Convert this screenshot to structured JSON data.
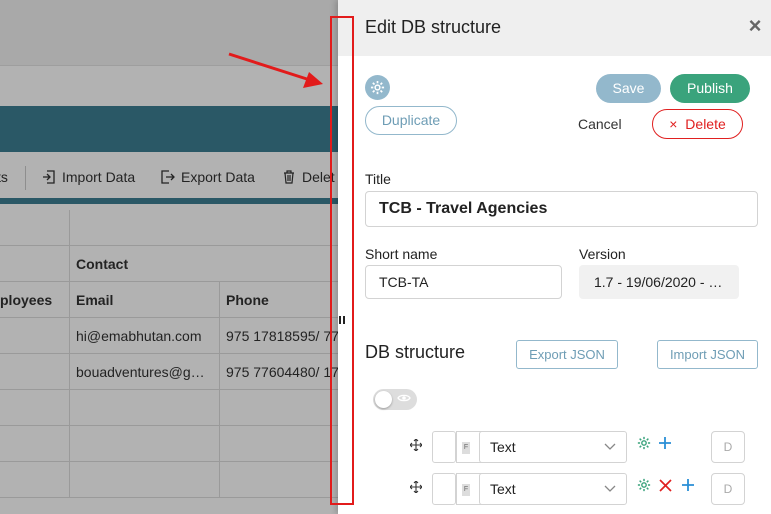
{
  "background": {
    "toolbar": {
      "items": [
        {
          "label": "ts",
          "icon": "cut-off-icon"
        },
        {
          "label": "Import Data",
          "icon": "import-icon"
        },
        {
          "label": "Export Data",
          "icon": "export-icon"
        },
        {
          "label": "Delet",
          "icon": "trash-icon"
        }
      ]
    },
    "table": {
      "group_header": "Contact",
      "headers": [
        "ployees",
        "Email",
        "Phone"
      ],
      "rows": [
        [
          "",
          "hi@emabhutan.com",
          "975 17818595/ 77"
        ],
        [
          "",
          "bouadventures@g…",
          "975 77604480/ 17"
        ],
        [
          "",
          "",
          ""
        ],
        [
          "",
          "",
          ""
        ],
        [
          "",
          "",
          ""
        ]
      ]
    }
  },
  "drawer": {
    "title": "Edit DB structure",
    "close_icon": "×",
    "actions": {
      "save": "Save",
      "publish": "Publish",
      "duplicate": "Duplicate",
      "cancel": "Cancel",
      "delete": "Delete",
      "delete_icon": "×"
    },
    "fields": {
      "title_label": "Title",
      "title_value": "TCB - Travel Agencies",
      "short_name_label": "Short name",
      "short_name_value": "TCB-TA",
      "version_label": "Version",
      "version_value": "1.7 - 19/06/2020 - …"
    },
    "db_structure": {
      "heading": "DB structure",
      "export_json": "Export JSON",
      "import_json": "Import JSON",
      "rows": [
        {
          "type": "Text",
          "tag": "F",
          "d_label": "D"
        },
        {
          "type": "Text",
          "tag": "F",
          "d_label": "D"
        }
      ]
    },
    "colors": {
      "publish": "#3aa37c",
      "save": "#93b8cc",
      "delete": "#e02020"
    }
  }
}
